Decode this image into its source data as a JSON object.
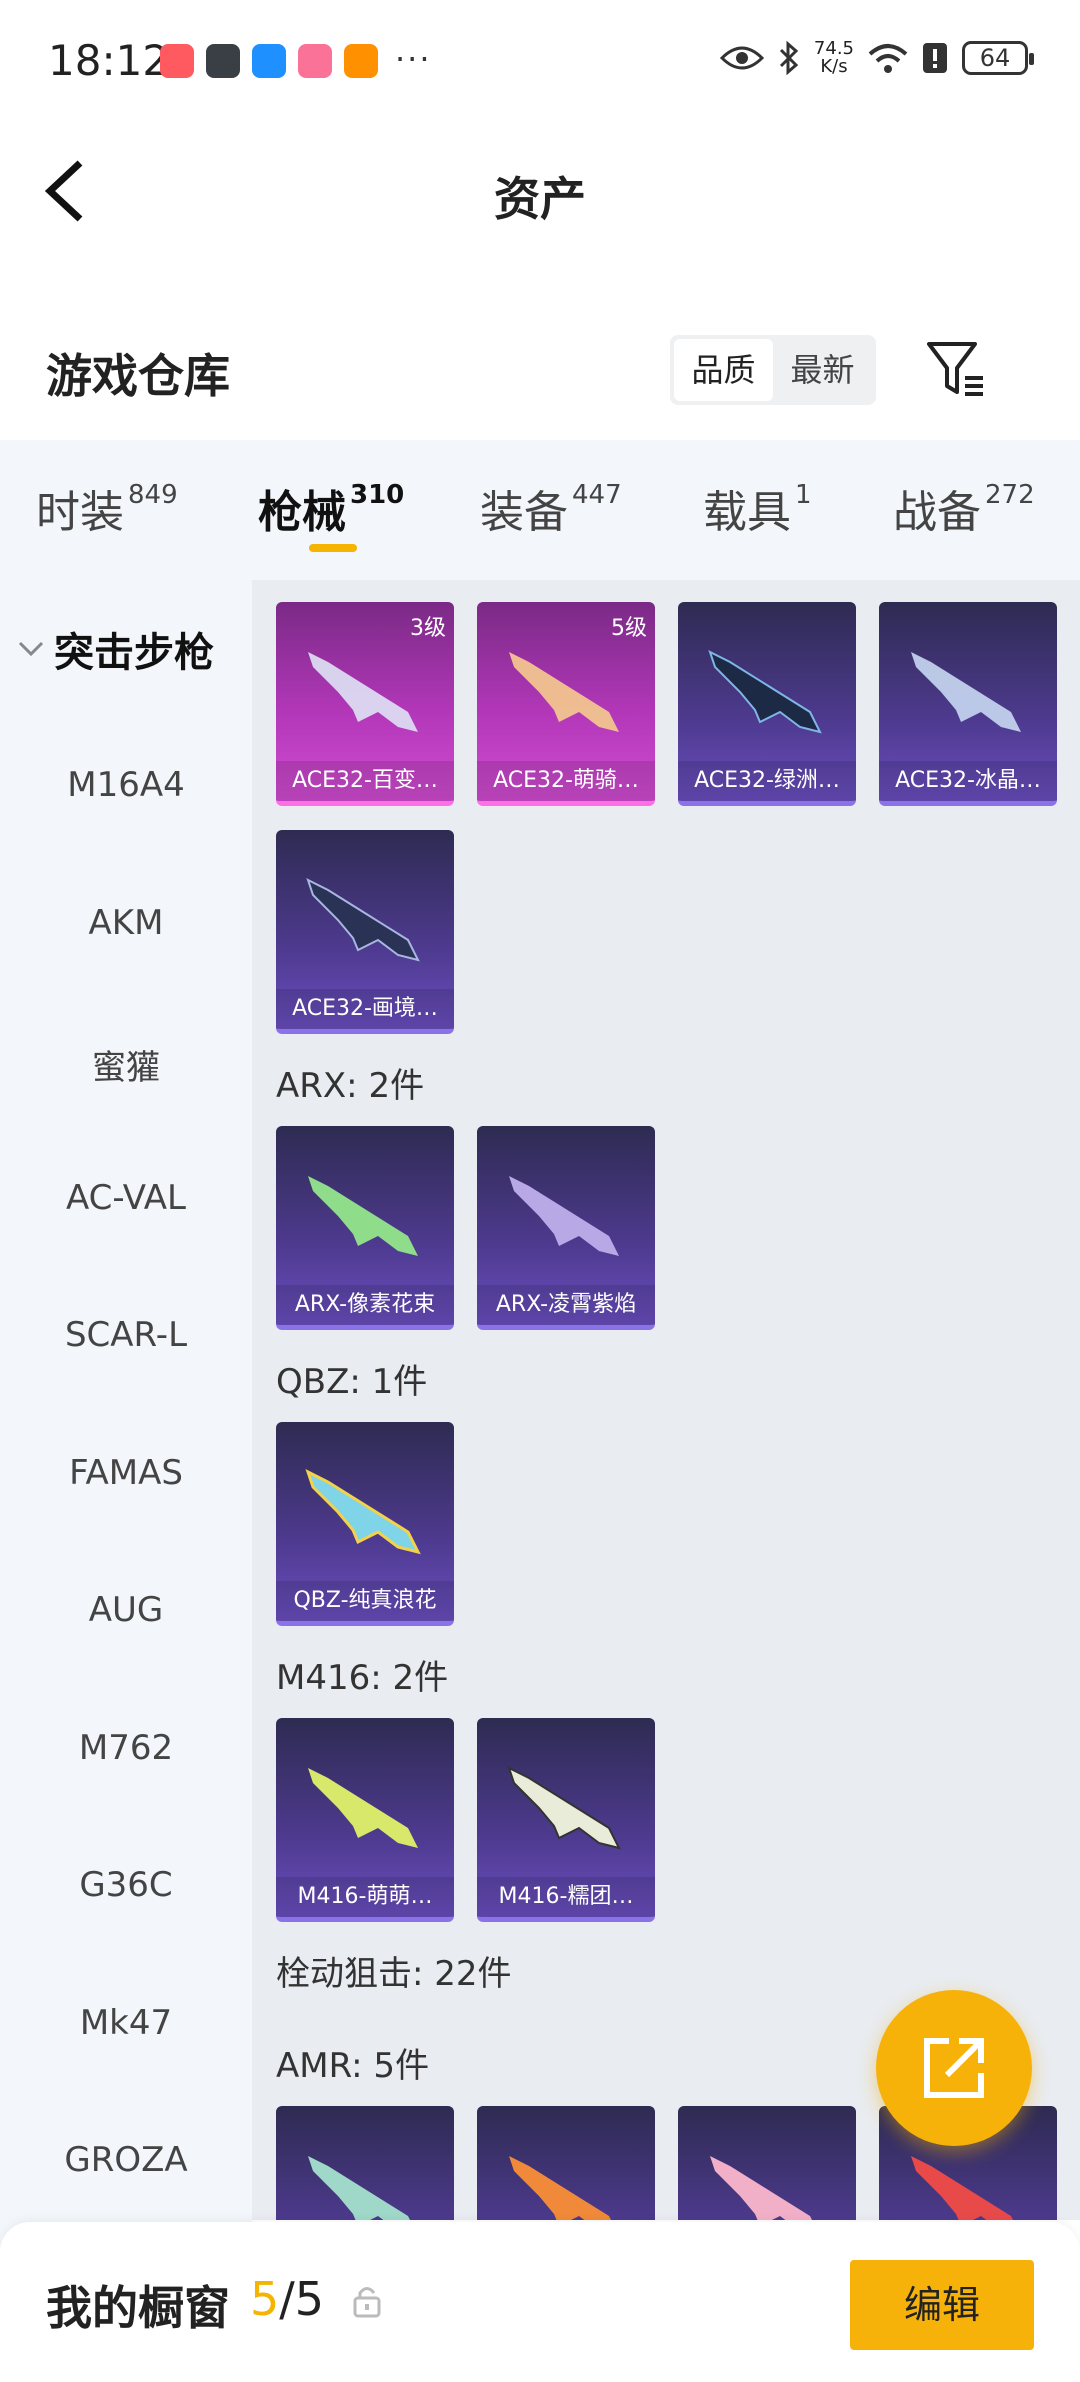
{
  "status_bar": {
    "time": "18:12",
    "speed_top": "74.5",
    "speed_unit": "K/s",
    "battery": "64"
  },
  "header": {
    "title": "资产"
  },
  "section": {
    "title": "游戏仓库",
    "sort_options": [
      "品质",
      "最新"
    ]
  },
  "tabs": [
    {
      "label": "时装",
      "count": "849"
    },
    {
      "label": "枪械",
      "count": "310"
    },
    {
      "label": "装备",
      "count": "447"
    },
    {
      "label": "载具",
      "count": "1"
    },
    {
      "label": "战备",
      "count": "272"
    }
  ],
  "categories": {
    "group": "突击步枪",
    "items": [
      "M16A4",
      "AKM",
      "蜜獾",
      "AC-VAL",
      "SCAR-L",
      "FAMAS",
      "AUG",
      "M762",
      "G36C",
      "Mk47",
      "GROZA"
    ]
  },
  "groups": {
    "arx": "ARX: 2件",
    "qbz": "QBZ: 1件",
    "m416": "M416: 2件",
    "bolt": "栓动狙击: 22件",
    "amr": "AMR: 5件"
  },
  "cards": {
    "ace1": {
      "name": "ACE32-百变…",
      "level": "3级"
    },
    "ace2": {
      "name": "ACE32-萌骑…",
      "level": "5级"
    },
    "ace3": {
      "name": "ACE32-绿洲…"
    },
    "ace4": {
      "name": "ACE32-冰晶…"
    },
    "ace5": {
      "name": "ACE32-画境…"
    },
    "arx1": {
      "name": "ARX-像素花束"
    },
    "arx2": {
      "name": "ARX-凌霄紫焰"
    },
    "qbz1": {
      "name": "QBZ-纯真浪花"
    },
    "m4161": {
      "name": "M416-萌萌…"
    },
    "m4162": {
      "name": "M416-糯团…"
    }
  },
  "bottom": {
    "title": "我的橱窗",
    "current": "5",
    "separator": "/",
    "total": "5",
    "edit_label": "编辑"
  },
  "colors": {
    "accent": "#f7b20a",
    "card_purple": "#4e3a8f",
    "card_pink": "#b237b8"
  }
}
